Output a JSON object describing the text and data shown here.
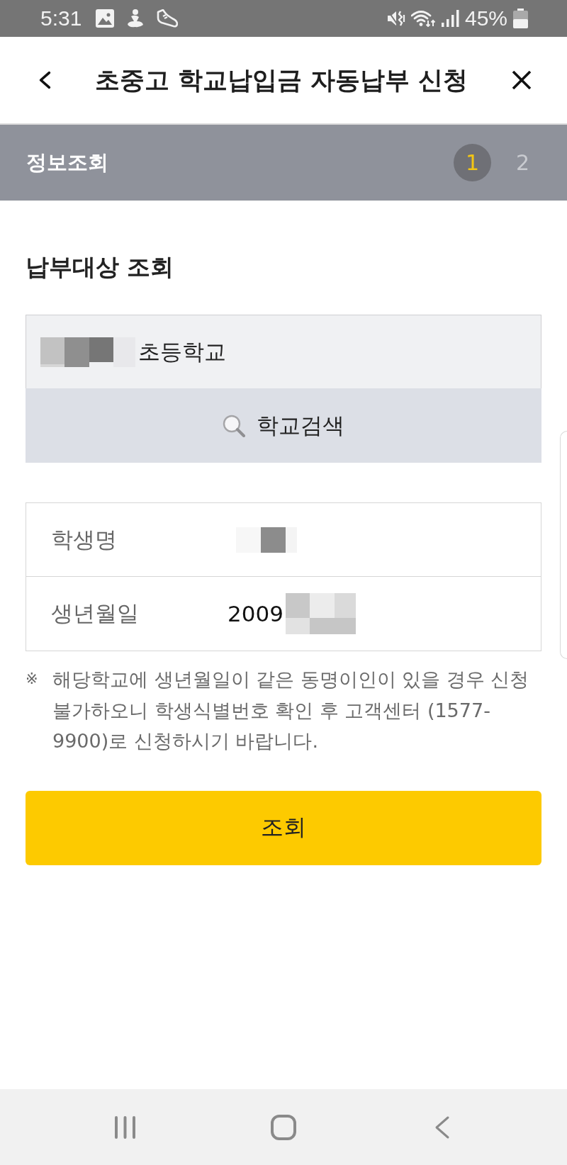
{
  "status_bar": {
    "time": "5:31",
    "battery": "45%"
  },
  "header": {
    "title": "초중고 학교납입금 자동납부 신청"
  },
  "step_bar": {
    "label": "정보조회",
    "steps": [
      {
        "label": "1",
        "selected": true
      },
      {
        "label": "2",
        "selected": false
      }
    ]
  },
  "section_title": "납부대상 조회",
  "school": {
    "value": "초등학교",
    "redacted": true,
    "search_button": "학교검색"
  },
  "student_info": [
    {
      "label": "학생명",
      "redacted": true
    },
    {
      "label": "생년월일",
      "value": "2009",
      "redacted": true
    }
  ],
  "note": {
    "mark": "※",
    "lines": [
      "해당학교에 생년월일이 같은 동명이인이 있을 경우 신청",
      "불가하오니 학생식별번호 확인 후 고객센터 (1577-",
      "9900)로 신청하시기 바랍니다."
    ]
  },
  "submit_button": "조회",
  "nav_bar": [
    {
      "kind": "recents"
    },
    {
      "kind": "home"
    },
    {
      "kind": "back"
    }
  ]
}
